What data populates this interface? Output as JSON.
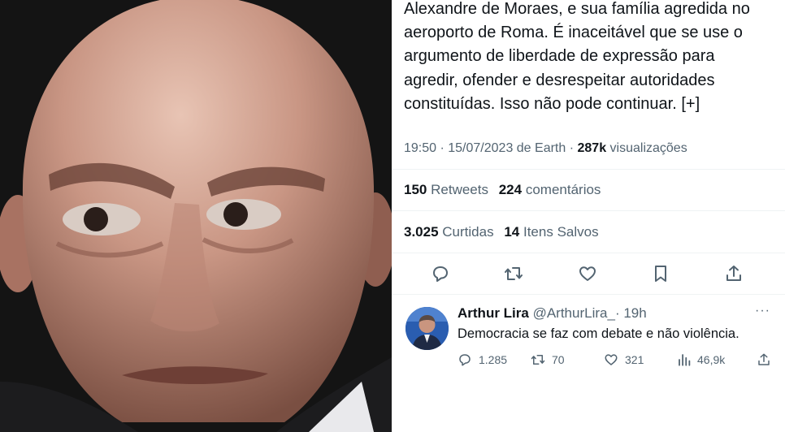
{
  "colors": {
    "text": "#0f1419",
    "secondary": "#536471",
    "divider": "#eff3f4",
    "photo_background": "#141414",
    "avatar_background": "#2a5db0"
  },
  "tweet": {
    "text_lines": [
      "Alexandre de Moraes, e sua família agredida no",
      "aeroporto de Roma. É inaceitável que se use o",
      "argumento de liberdade de expressão para",
      "agredir, ofender e desrespeitar autoridades",
      "constituídas. Isso não pode continuar. [+]"
    ],
    "meta": {
      "time_and_source": "19:50 · 15/07/2023 de Earth ·",
      "views_count": "287k",
      "views_label": "visualizações"
    },
    "stats": {
      "retweets_count": "150",
      "retweets_label": "Retweets",
      "comments_count": "224",
      "comments_label": "comentários",
      "likes_count": "3.025",
      "likes_label": "Curtidas",
      "saves_count": "14",
      "saves_label": "Itens Salvos"
    },
    "actions": [
      "comment-icon",
      "retweet-icon",
      "heart-icon",
      "bookmark-icon",
      "share-icon"
    ]
  },
  "reply": {
    "name": "Arthur Lira",
    "handle": "@ArthurLira_",
    "time": "· 19h",
    "more": "···",
    "text": "Democracia se faz com debate e não violência.",
    "replies": "1.285",
    "retweets": "70",
    "likes": "321",
    "views": "46,9k",
    "icons": [
      "comment-icon",
      "retweet-icon",
      "heart-icon",
      "views-icon",
      "share-icon"
    ]
  }
}
